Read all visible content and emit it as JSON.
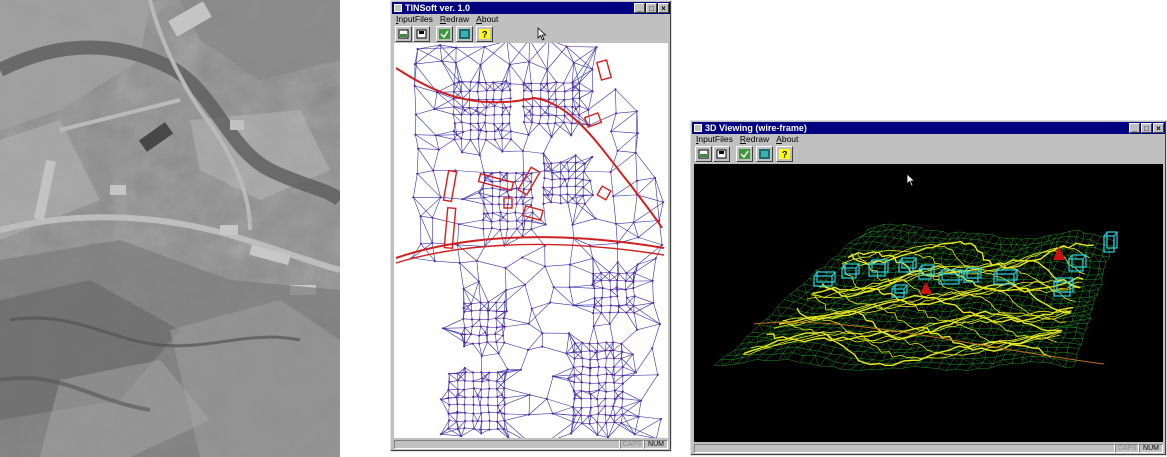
{
  "window_2d": {
    "title": "TINSoft ver. 1.0",
    "menu": [
      "InputFiles",
      "Redraw",
      "About"
    ],
    "toolbar_icons": [
      "open-file-icon",
      "save-file-icon",
      "check-icon",
      "terrain-icon",
      "help-icon"
    ],
    "status": {
      "caps": "CAPS",
      "num": "NUM"
    }
  },
  "window_3d": {
    "title": "3D Viewing (wire-frame)",
    "menu": [
      "InputFiles",
      "Redraw",
      "About"
    ],
    "toolbar_icons": [
      "open-file-icon",
      "save-file-icon",
      "check-icon",
      "terrain-icon",
      "help-icon"
    ],
    "status": {
      "caps": "CAPS",
      "num": "NUM"
    }
  },
  "colors": {
    "title_bar": "#000080",
    "window_face": "#c0c0c0",
    "tin_edges": "#3030a8",
    "tin_vertices": "#6a1fa0",
    "breaklines": "#d02020",
    "wire_terrain": "#1f9a1f",
    "wire_contours": "#e8e820",
    "buildings_3d": "#30d0e0",
    "markers_3d": "#d01010"
  }
}
